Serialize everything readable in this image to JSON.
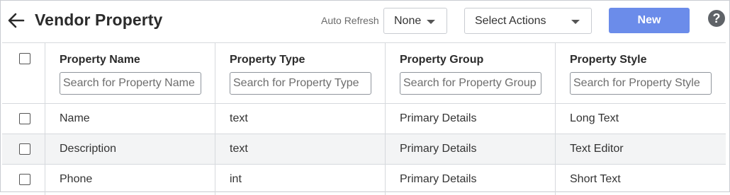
{
  "header": {
    "title": "Vendor Property",
    "auto_refresh_label": "Auto Refresh",
    "auto_refresh_value": "None",
    "actions_value": "Select Actions",
    "new_label": "New",
    "help_glyph": "?"
  },
  "icons": {
    "back": "arrow-left-icon",
    "help": "question-circle-icon",
    "caret": "chevron-down-icon"
  },
  "colors": {
    "primary_button": "#6b8cea",
    "alt_row": "#f3f4f5"
  },
  "table": {
    "columns": [
      {
        "title": "Property Name",
        "placeholder": "Search for Property Name"
      },
      {
        "title": "Property Type",
        "placeholder": "Search for Property Type"
      },
      {
        "title": "Property Group",
        "placeholder": "Search for Property Group"
      },
      {
        "title": "Property Style",
        "placeholder": "Search for Property Style"
      }
    ],
    "rows": [
      [
        "Name",
        "text",
        "Primary Details",
        "Long Text"
      ],
      [
        "Description",
        "text",
        "Primary Details",
        "Text Editor"
      ],
      [
        "Phone",
        "int",
        "Primary Details",
        "Short Text"
      ]
    ]
  }
}
